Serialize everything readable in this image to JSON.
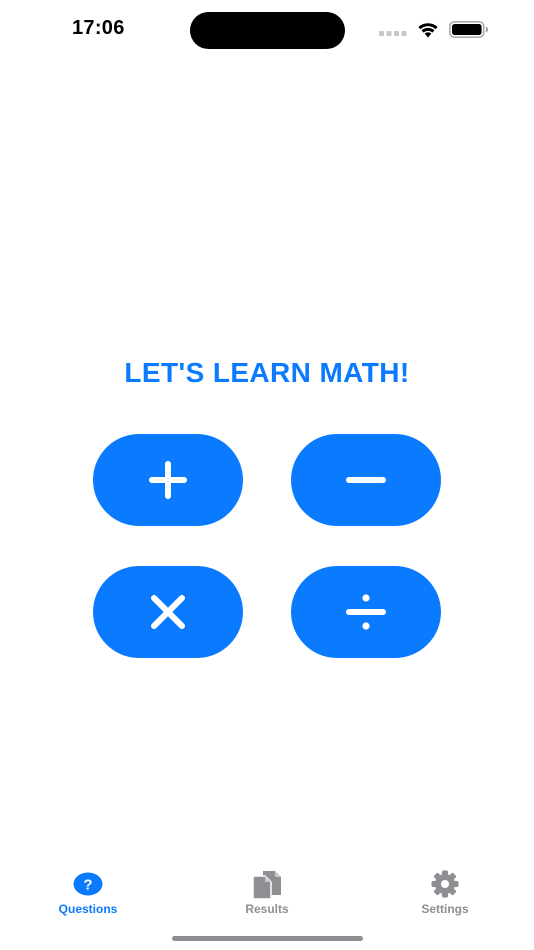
{
  "status_bar": {
    "time": "17:06"
  },
  "main": {
    "title": "LET'S LEARN MATH!",
    "operations": [
      {
        "name": "addition",
        "symbol": "+"
      },
      {
        "name": "subtraction",
        "symbol": "−"
      },
      {
        "name": "multiplication",
        "symbol": "×"
      },
      {
        "name": "division",
        "symbol": "÷"
      }
    ]
  },
  "tab_bar": {
    "tabs": [
      {
        "label": "Questions",
        "icon": "question-circle-icon",
        "selected": true
      },
      {
        "label": "Results",
        "icon": "documents-icon",
        "selected": false
      },
      {
        "label": "Settings",
        "icon": "gear-icon",
        "selected": false
      }
    ]
  },
  "colors": {
    "accent": "#0a7aff",
    "inactive": "#8e8e93",
    "background": "#ffffff"
  }
}
